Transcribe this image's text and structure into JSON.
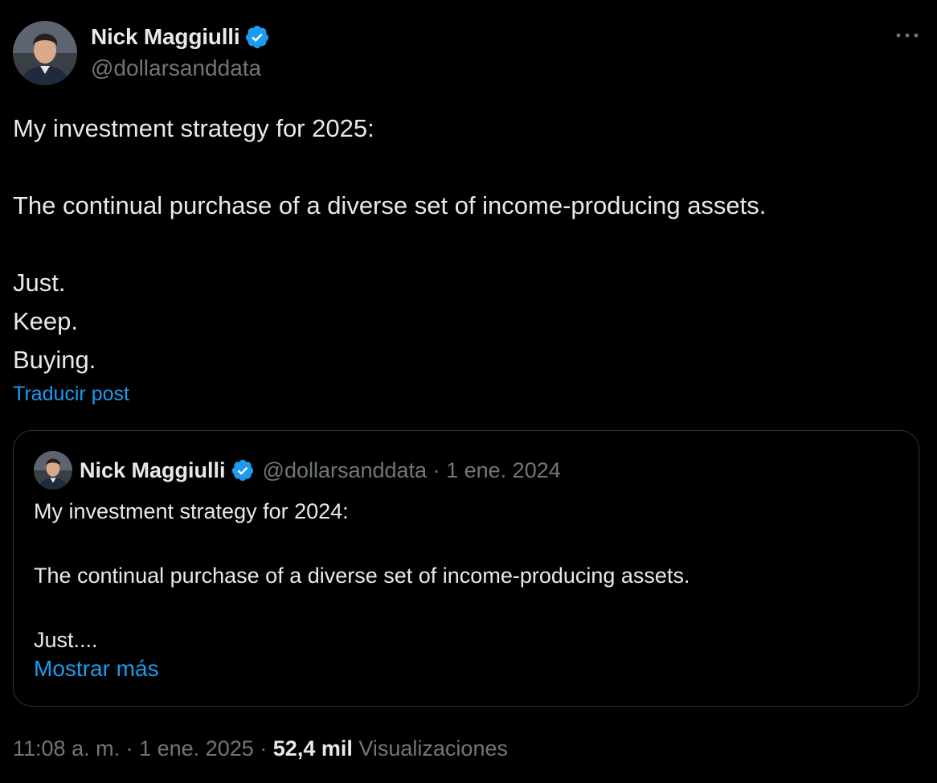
{
  "author": {
    "display_name": "Nick Maggiulli",
    "handle": "@dollarsanddata",
    "avatar_icon": "person-avatar",
    "verified_icon": "verified-badge-icon"
  },
  "more_icon": "more-horizontal-icon",
  "post": {
    "lines": [
      "My investment strategy for 2025:",
      "",
      "The continual purchase of a diverse set of income-producing assets.",
      "",
      "Just.",
      "Keep.",
      "Buying."
    ],
    "translate_label": "Traducir post"
  },
  "quoted": {
    "display_name": "Nick Maggiulli",
    "handle": "@dollarsanddata",
    "separator": "·",
    "date": "1 ene. 2024",
    "lines": [
      "My investment strategy for 2024:",
      "",
      "The continual purchase of a diverse set of income-producing assets.",
      "",
      "Just...."
    ],
    "show_more_label": "Mostrar más"
  },
  "footer": {
    "time": "11:08 a. m.",
    "separator": "·",
    "date": "1 ene. 2025",
    "views_count": "52,4 mil",
    "views_label": "Visualizaciones"
  },
  "colors": {
    "background": "#000000",
    "text": "#e7e9ea",
    "muted": "#71767b",
    "accent": "#1d9bf0",
    "border": "#2f3336"
  }
}
